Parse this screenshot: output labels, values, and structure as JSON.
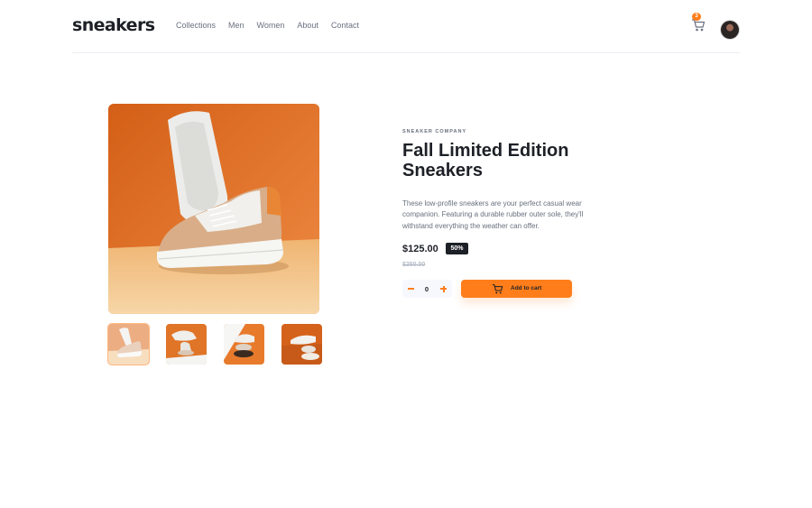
{
  "header": {
    "logo": "sneakers",
    "nav": [
      "Collections",
      "Men",
      "Women",
      "About",
      "Contact"
    ],
    "cart_count": "3",
    "cart_icon": "cart-icon",
    "avatar": "user-avatar"
  },
  "product": {
    "company": "SNEAKER COMPANY",
    "title": "Fall Limited Edition Sneakers",
    "description": "These low-profile sneakers are your perfect casual wear companion. Featuring a durable rubber outer sole, they'll withstand everything the weather can offer.",
    "price": "$125.00",
    "discount": "50%",
    "original_price": "$250.00",
    "quantity": "0",
    "add_to_cart_label": "Add to cart"
  },
  "gallery": {
    "thumbnail_count": 4,
    "selected_thumbnail": 1
  },
  "colors": {
    "accent": "#ff7e1b",
    "text_dark": "#1d2026",
    "text_muted": "#68707d",
    "light_bg": "#f7f8fd"
  }
}
